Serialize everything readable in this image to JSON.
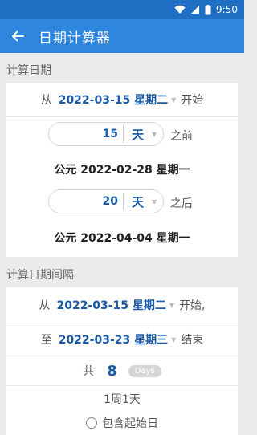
{
  "status_bar": {
    "time": "9:50"
  },
  "app_bar": {
    "title": "日期计算器",
    "back_icon": "arrow-back-icon"
  },
  "calc_date": {
    "section_title": "计算日期",
    "from_prefix": "从",
    "from_date": "2022-03-15 星期二",
    "from_suffix": "开始",
    "before": {
      "value": "15",
      "unit": "天",
      "suffix": "之前",
      "result": "公元 2022-02-28 星期一"
    },
    "after": {
      "value": "20",
      "unit": "天",
      "suffix": "之后",
      "result": "公元 2022-04-04 星期一"
    }
  },
  "calc_interval": {
    "section_title": "计算日期间隔",
    "from_prefix": "从",
    "from_date": "2022-03-15 星期二",
    "from_suffix": "开始,",
    "to_prefix": "至",
    "to_date": "2022-03-23 星期三",
    "to_suffix": "结束",
    "total_prefix": "共",
    "total_value": "8",
    "total_unit": "Days",
    "breakdown": "1周1天",
    "include_start_label": "包含起始日",
    "include_start_checked": false
  },
  "colors": {
    "status_bar": "#1f6fc4",
    "app_bar": "#2f86dd",
    "accent_text": "#1b5aa6",
    "background": "#ebebeb"
  }
}
